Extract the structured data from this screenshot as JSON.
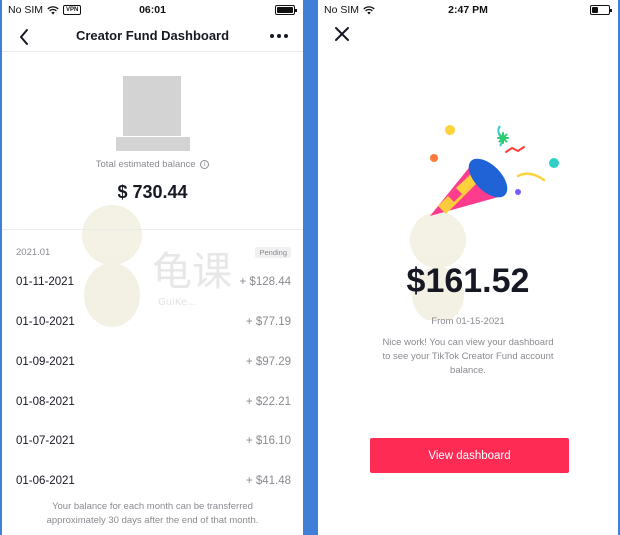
{
  "left_screen": {
    "status": {
      "carrier": "No SIM",
      "vpn": "VPN",
      "time": "06:01"
    },
    "header": {
      "title": "Creator Fund Dashboard"
    },
    "balance": {
      "label": "Total estimated balance",
      "info_symbol": "i",
      "amount": "$ 730.44"
    },
    "period": {
      "month": "2021.01",
      "status": "Pending"
    },
    "transactions": [
      {
        "date": "01-11-2021",
        "amount": "+ $128.44"
      },
      {
        "date": "01-10-2021",
        "amount": "+ $77.19"
      },
      {
        "date": "01-09-2021",
        "amount": "+ $97.29"
      },
      {
        "date": "01-08-2021",
        "amount": "+ $22.21"
      },
      {
        "date": "01-07-2021",
        "amount": "+ $16.10"
      },
      {
        "date": "01-06-2021",
        "amount": "+ $41.48"
      }
    ],
    "footer_note": "Your balance for each month can be transferred approximately 30 days after the end of that month."
  },
  "right_screen": {
    "status": {
      "carrier": "No SIM",
      "time": "2:47 PM"
    },
    "amount": "$161.52",
    "from_date": "From 01-15-2021",
    "message": "Nice work! You can view your dashboard to see your TikTok Creator Fund account balance.",
    "button_label": "View dashboard"
  },
  "watermark": {
    "text": "龟课",
    "subtext": "GuiKe..."
  },
  "icons": {
    "back": "chevron-left-icon",
    "more": "more-horizontal-icon",
    "close": "close-icon",
    "wifi": "wifi-icon",
    "battery": "battery-icon",
    "info": "info-icon",
    "celebration": "party-popper-icon"
  },
  "colors": {
    "accent": "#fe2c55",
    "text_primary": "#161823",
    "text_secondary": "#8a8b91",
    "frame": "#3f7fd8"
  }
}
